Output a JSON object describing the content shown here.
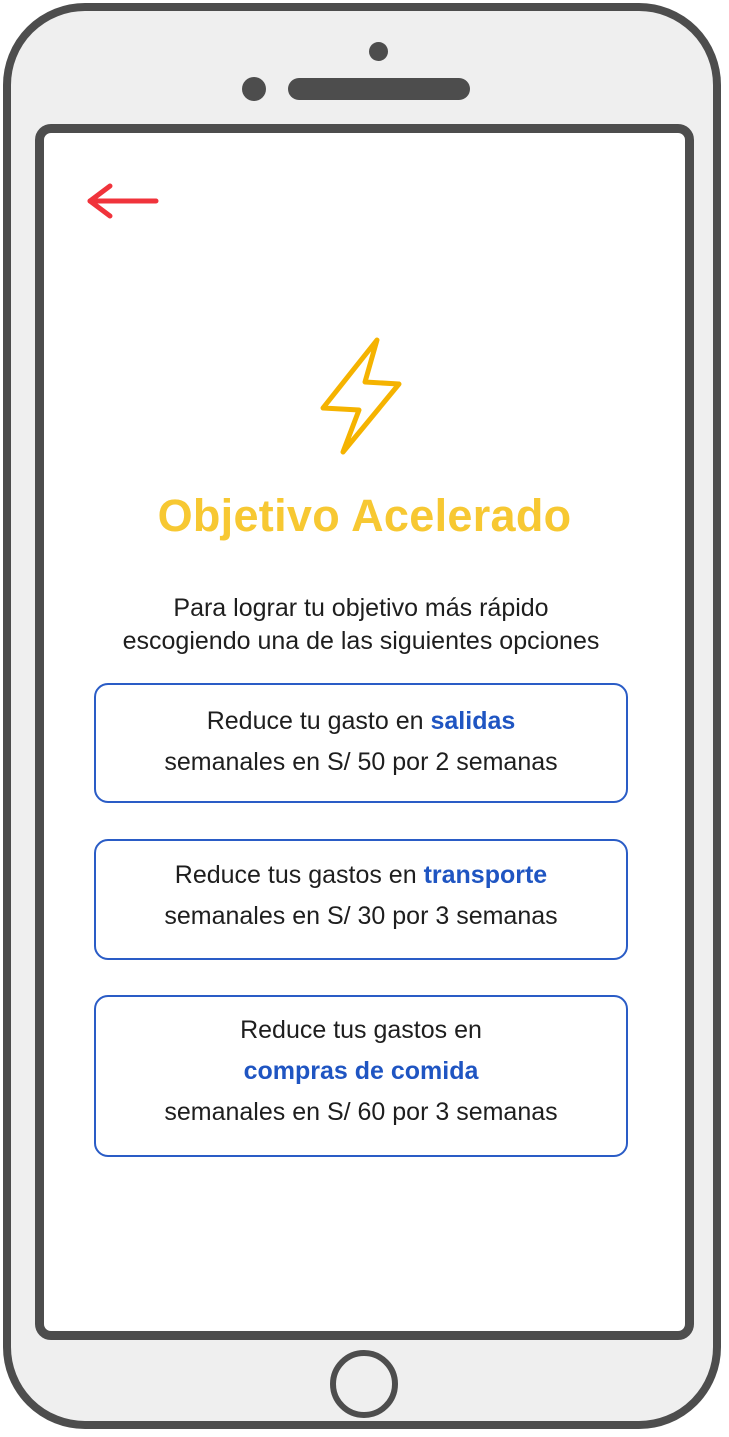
{
  "colors": {
    "accent_yellow": "#f7c832",
    "accent_blue": "#1f55c2",
    "back_arrow_red": "#f0333b",
    "frame_gray": "#4d4d4d"
  },
  "header": {
    "back_icon": "arrow-left-icon",
    "hero_icon": "lightning-bolt-icon",
    "title": "Objetivo Acelerado",
    "subtitle_line1": "Para lograr tu objetivo más rápido",
    "subtitle_line2": "escogiendo una de las siguientes opciones"
  },
  "options": [
    {
      "prefix": "Reduce tu gasto en",
      "highlight": "salidas",
      "suffix": "semanales en S/ 50 por 2 semanas"
    },
    {
      "prefix": "Reduce tus gastos en",
      "highlight": "transporte",
      "suffix": "semanales en S/ 30 por 3 semanas"
    },
    {
      "prefix": "Reduce tus gastos en",
      "highlight": "compras de comida",
      "suffix": "semanales en S/ 60 por 3 semanas"
    }
  ]
}
